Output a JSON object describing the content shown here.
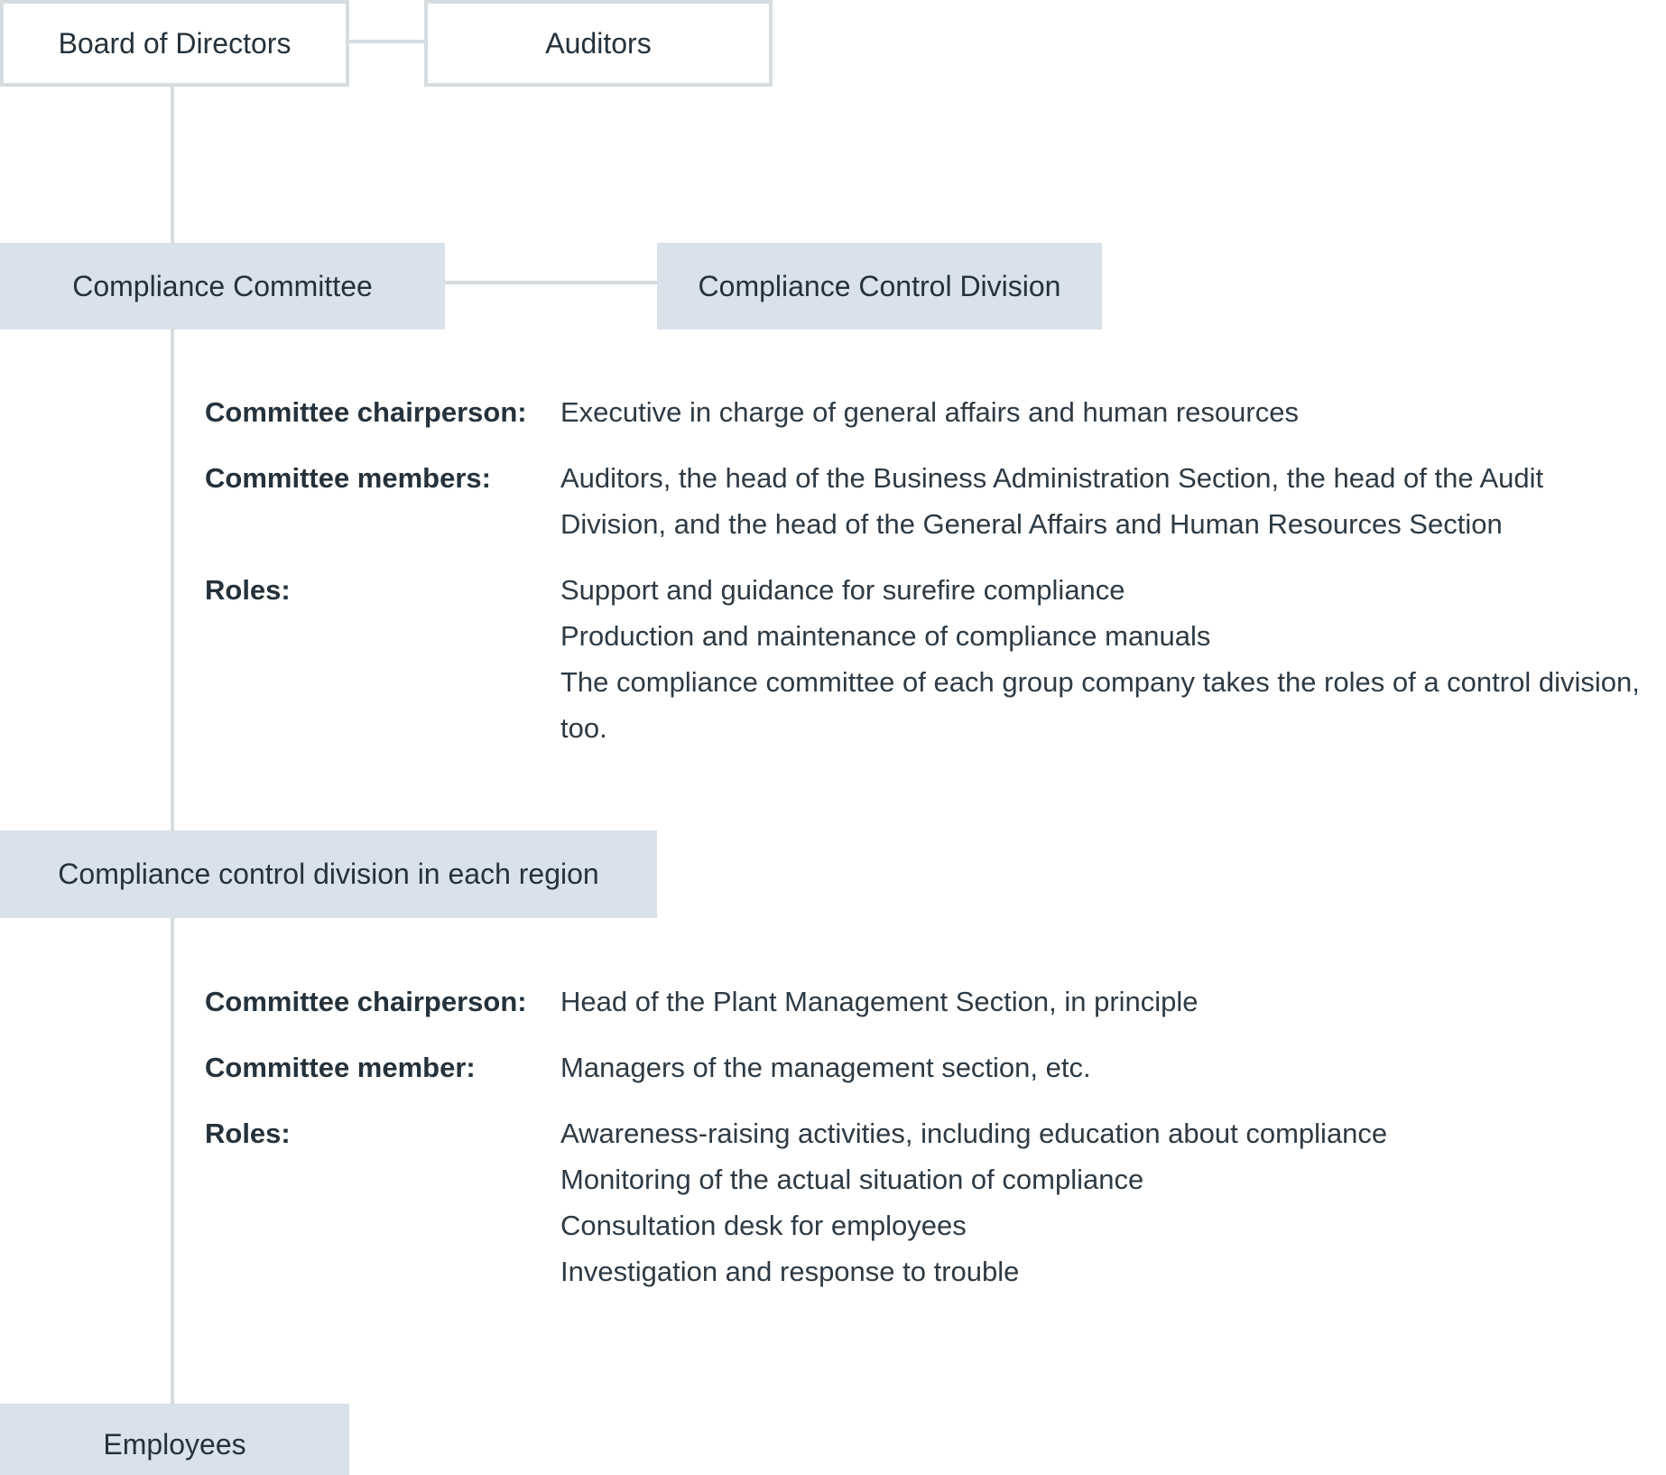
{
  "diagram": {
    "nodes": {
      "board": "Board of Directors",
      "auditors": "Auditors",
      "compliance_committee": "Compliance Committee",
      "compliance_control_division": "Compliance Control Division",
      "regional_division": "Compliance control division in each region",
      "employees": "Employees"
    },
    "committee_details": {
      "chairperson_label": "Committee chairperson:",
      "chairperson_value": "Executive in charge of general affairs and human resources",
      "members_label": "Committee members:",
      "members_value": "Auditors, the head of the Business Administration Section, the head of the Audit Division, and the head of the General Affairs and Human Resources Section",
      "roles_label": "Roles:",
      "roles": [
        "Support and guidance for surefire compliance",
        "Production and maintenance of compliance manuals",
        "The compliance committee of each group company takes the roles of a control division, too."
      ]
    },
    "regional_details": {
      "chairperson_label": "Committee chairperson:",
      "chairperson_value": "Head of the Plant Management Section, in principle",
      "member_label": "Committee member:",
      "member_value": "Managers of the management section, etc.",
      "roles_label": "Roles:",
      "roles": [
        "Awareness-raising activities, including education about compliance",
        "Monitoring of the actual situation of compliance",
        "Consultation desk for employees",
        "Investigation and response to trouble"
      ]
    },
    "colors": {
      "filled_box": "#d9e1ea",
      "connector": "#d7dce1",
      "text": "#25323c"
    }
  }
}
